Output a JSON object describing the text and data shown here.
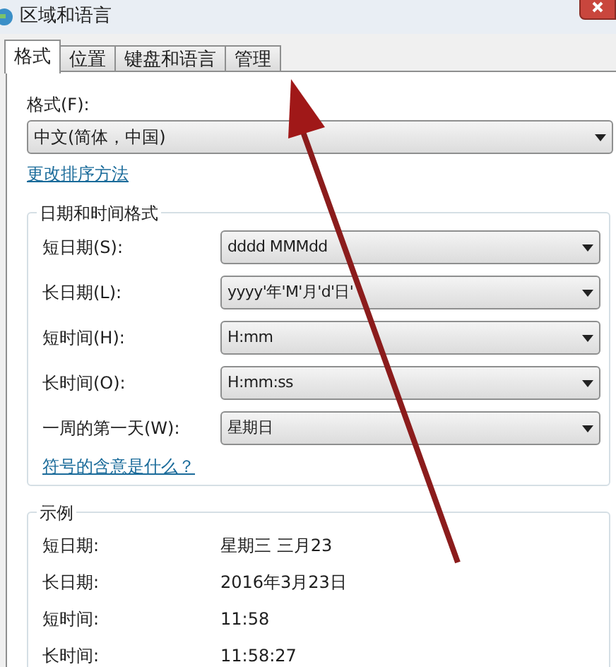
{
  "window": {
    "title": "区域和语言"
  },
  "tabs": [
    {
      "label": "格式",
      "selected": true
    },
    {
      "label": "位置",
      "selected": false
    },
    {
      "label": "键盘和语言",
      "selected": false
    },
    {
      "label": "管理",
      "selected": false
    }
  ],
  "format": {
    "label": "格式(F):",
    "value": "中文(简体，中国)"
  },
  "sort_link": "更改排序方法",
  "datetime_group": {
    "title": "日期和时间格式",
    "rows": [
      {
        "label": "短日期(S):",
        "value": "dddd  MMMdd"
      },
      {
        "label": "长日期(L):",
        "value": "yyyy'年'M'月'd'日'"
      },
      {
        "label": "短时间(H):",
        "value": "H:mm"
      },
      {
        "label": "长时间(O):",
        "value": "H:mm:ss"
      },
      {
        "label": "一周的第一天(W):",
        "value": "星期日"
      }
    ],
    "link": "符号的含意是什么？"
  },
  "example_group": {
    "title": "示例",
    "rows": [
      {
        "label": "短日期:",
        "value": "星期三  三月23"
      },
      {
        "label": "长日期:",
        "value": "2016年3月23日"
      },
      {
        "label": "短时间:",
        "value": "11:58"
      },
      {
        "label": "长时间:",
        "value": "11:58:27"
      }
    ]
  }
}
